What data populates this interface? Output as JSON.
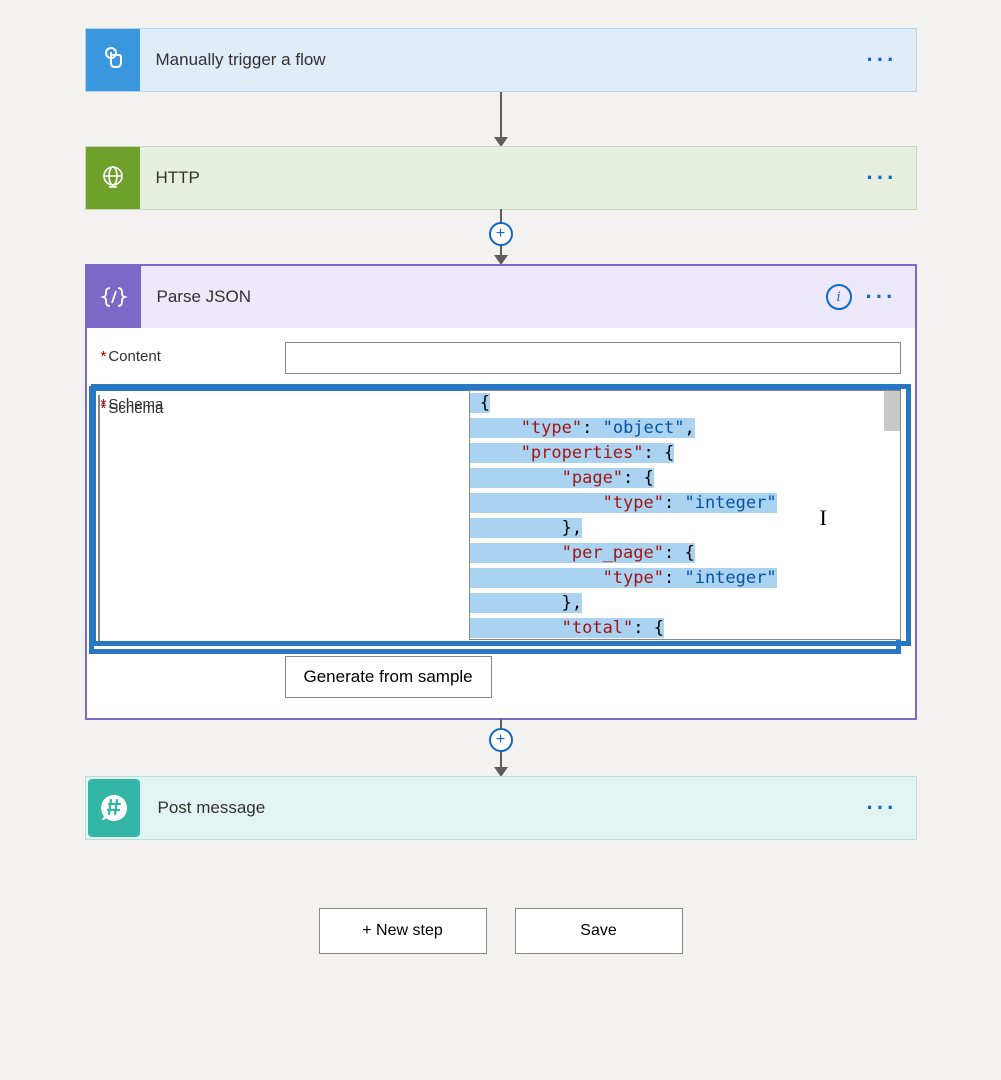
{
  "steps": {
    "trigger": {
      "title": "Manually trigger a flow"
    },
    "http": {
      "title": "HTTP"
    },
    "parse": {
      "title": "Parse JSON",
      "content_label": "Content",
      "schema_label": "Schema",
      "generate_btn": "Generate from sample"
    },
    "post": {
      "title": "Post message"
    }
  },
  "schema_code": [
    {
      "indent": 0,
      "tokens": [
        [
          "p",
          "{"
        ]
      ]
    },
    {
      "indent": 1,
      "tokens": [
        [
          "k",
          "\"type\""
        ],
        [
          "p",
          ": "
        ],
        [
          "v",
          "\"object\""
        ],
        [
          "p",
          ","
        ]
      ]
    },
    {
      "indent": 1,
      "tokens": [
        [
          "k",
          "\"properties\""
        ],
        [
          "p",
          ": {"
        ]
      ]
    },
    {
      "indent": 2,
      "tokens": [
        [
          "k",
          "\"page\""
        ],
        [
          "p",
          ": {"
        ]
      ]
    },
    {
      "indent": 3,
      "tokens": [
        [
          "k",
          "\"type\""
        ],
        [
          "p",
          ": "
        ],
        [
          "v",
          "\"integer\""
        ]
      ]
    },
    {
      "indent": 2,
      "tokens": [
        [
          "p",
          "},"
        ]
      ]
    },
    {
      "indent": 2,
      "tokens": [
        [
          "k",
          "\"per_page\""
        ],
        [
          "p",
          ": {"
        ]
      ]
    },
    {
      "indent": 3,
      "tokens": [
        [
          "k",
          "\"type\""
        ],
        [
          "p",
          ": "
        ],
        [
          "v",
          "\"integer\""
        ]
      ]
    },
    {
      "indent": 2,
      "tokens": [
        [
          "p",
          "},"
        ]
      ]
    },
    {
      "indent": 2,
      "tokens": [
        [
          "k",
          "\"total\""
        ],
        [
          "p",
          ": {"
        ]
      ]
    }
  ],
  "buttons": {
    "new_step": "+ New step",
    "save": "Save"
  },
  "glyphs": {
    "info": "i",
    "plus": "+",
    "ellipsis": "···"
  }
}
